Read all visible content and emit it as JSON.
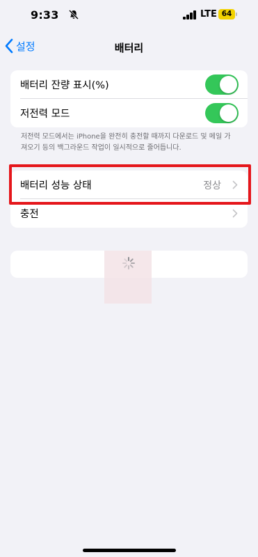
{
  "status_bar": {
    "time": "9:33",
    "network": "LTE",
    "battery_level": "64",
    "icons": [
      "bell-slash-icon",
      "signal-bars-icon",
      "battery-icon"
    ]
  },
  "nav": {
    "back_label": "설정",
    "title": "배터리"
  },
  "settings_group_1": {
    "items": [
      {
        "label": "배터리 잔량 표시(%)",
        "toggle": "on"
      },
      {
        "label": "저전력 모드",
        "toggle": "on"
      }
    ],
    "footnote": "저전력 모드에서는 iPhone을 완전히 충전할 때까지 다운로드 및 메일 가져오기 등의 백그라운드 작업이 일시적으로 줄어듭니다."
  },
  "settings_group_2": {
    "items": [
      {
        "label": "배터리 성능 상태",
        "value": "정상"
      },
      {
        "label": "충전"
      }
    ]
  },
  "colors": {
    "accent": "#007aff",
    "toggle_on": "#34c759",
    "highlight": "#e5161b",
    "battery": "#f2d200"
  }
}
